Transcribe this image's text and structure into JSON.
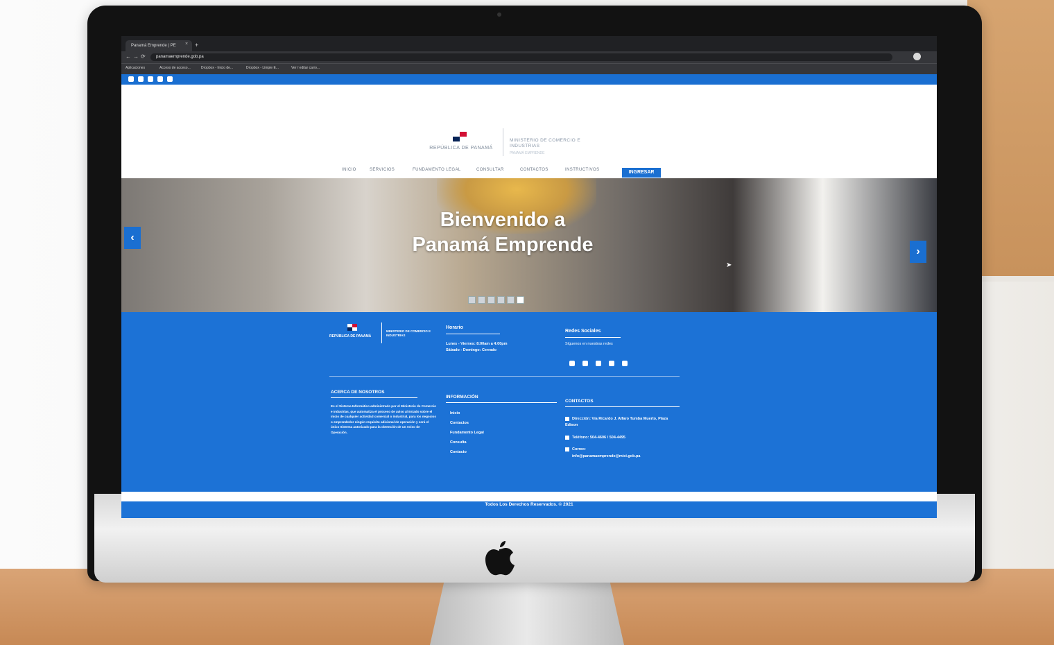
{
  "browser": {
    "tab_title": "Panamá Emprende | PE",
    "tab_close": "×",
    "new_tab": "+",
    "url": "panamaemprende.gob.pa",
    "nav_back": "←",
    "nav_forward": "→",
    "nav_reload": "⟳",
    "bookmarks": [
      "Aplicaciones",
      "Acceso de acceso...",
      "Dropbox - Inicio de...",
      "Dropbox - Limpie E...",
      "Ver / editar carro..."
    ]
  },
  "header": {
    "republic": "REPÚBLICA DE PANAMÁ",
    "ministry": "MINISTERIO DE COMERCIO E INDUSTRIAS",
    "ministry_sub": "PANAMÁ EMPRENDE"
  },
  "nav": {
    "items": [
      "INICIO",
      "SERVICIOS",
      "FUNDAMENTO LEGAL",
      "CONSULTAR",
      "CONTACTOS",
      "INSTRUCTIVOS"
    ],
    "login": "INGRESAR"
  },
  "hero": {
    "title_line1": "Bienvenido a",
    "title_line2": "Panamá Emprende",
    "prev": "‹",
    "next": "›",
    "slide_count": 6,
    "active_slide": 6
  },
  "footer": {
    "logo_republic": "REPÚBLICA DE PANAMÁ",
    "logo_ministry": "MINISTERIO DE COMERCIO E INDUSTRIAS",
    "horario_title": "Horario",
    "horario_lines": [
      "Lunes - Viernes: 8:00am a 4:00pm",
      "Sábado - Domingo: Cerrado"
    ],
    "redes_title": "Redes Sociales",
    "redes_sub": "Síguenos en nuestras redes",
    "acerca_title": "ACERCA DE NOSOTROS",
    "acerca_text": "Es el Sistema Informático administrado por el Ministerio de Comercio e Industrias, que automatiza el proceso de aviso al Estado sobre el inicio de cualquier actividad comercial o industrial, para los negocios o emprendedor ningún requisito adicional de operación y será el único Sistema autorizado para la obtención de un Aviso de Operación.",
    "info_title": "INFORMACIÓN",
    "info_links": [
      "Inicio",
      "Contactos",
      "Fundamento Legal",
      "Consulta",
      "Contacto"
    ],
    "contactos_title": "CONTACTOS",
    "direccion": "Dirección: Vía Ricardo J. Alfaro Tumba Muerto, Plaza Edison",
    "telefono": "Teléfono: 504-4606 / 504-4495",
    "correo_label": "Correo:",
    "correo": "info@panamaemprende@mici.gob.pa",
    "copyright": "Todos Los Derechos Reservados. © 2021"
  },
  "colors": {
    "brand_blue": "#1c72d6",
    "nav_blue": "#1a6fd1",
    "flag_red": "#d21034",
    "flag_blue": "#072357"
  }
}
